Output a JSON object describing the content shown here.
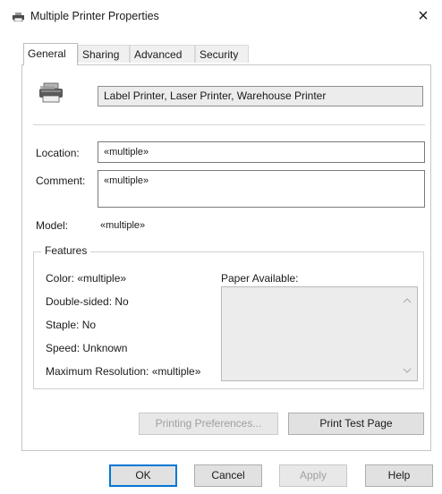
{
  "window": {
    "title": "Multiple Printer Properties",
    "close_glyph": "×"
  },
  "tabs": [
    {
      "label": "General"
    },
    {
      "label": "Sharing"
    },
    {
      "label": "Advanced"
    },
    {
      "label": "Security"
    }
  ],
  "general": {
    "printers_value": "Label Printer, Laser Printer, Warehouse Printer",
    "location_label": "Location:",
    "location_value": "«multiple»",
    "comment_label": "Comment:",
    "comment_value": "«multiple»",
    "model_label": "Model:",
    "model_value": "«multiple»"
  },
  "features": {
    "title": "Features",
    "color": "Color:  «multiple»",
    "double_sided": "Double-sided:  No",
    "staple": "Staple:  No",
    "speed": "Speed:  Unknown",
    "max_resolution": "Maximum Resolution:  «multiple»",
    "paper_available_label": "Paper Available:"
  },
  "buttons": {
    "printing_preferences": "Printing Preferences...",
    "print_test_page": "Print Test Page",
    "ok": "OK",
    "cancel": "Cancel",
    "apply": "Apply",
    "help": "Help"
  },
  "icons": {
    "title": "printer-icon",
    "printer_group": "printer-stack-icon",
    "close": "close-icon",
    "scroll_up": "chevron-up-icon",
    "scroll_down": "chevron-down-icon"
  },
  "colors": {
    "accent": "#0078d7",
    "disabled_text": "#a0a0a0"
  }
}
